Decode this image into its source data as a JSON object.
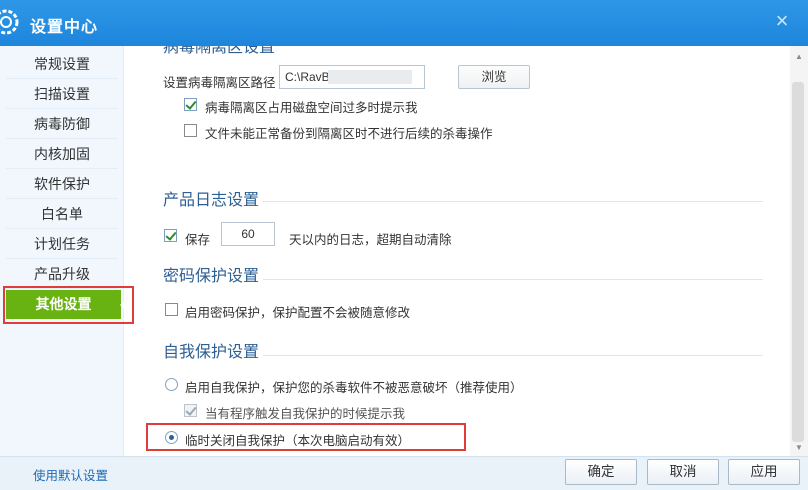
{
  "window": {
    "title": "设置中心",
    "close_glyph": "×"
  },
  "sidebar": {
    "items": [
      {
        "label": "常规设置"
      },
      {
        "label": "扫描设置"
      },
      {
        "label": "病毒防御"
      },
      {
        "label": "内核加固"
      },
      {
        "label": "软件保护"
      },
      {
        "label": "白名单"
      },
      {
        "label": "计划任务"
      },
      {
        "label": "产品升级"
      },
      {
        "label": "其他设置"
      }
    ],
    "selected": "其他设置"
  },
  "quarantine": {
    "heading_partial": "病毒隔离区设置",
    "path_label": "设置病毒隔离区路径",
    "path_value": "C:\\RavBin",
    "browse_label": "浏览",
    "opt_disk_warn": {
      "label": "病毒隔离区占用磁盘空间过多时提示我",
      "checked": true
    },
    "opt_no_backup": {
      "label": "文件未能正常备份到隔离区时不进行后续的杀毒操作",
      "checked": false
    }
  },
  "log": {
    "heading": "产品日志设置",
    "save_label": "保存",
    "save_checked": true,
    "days_value": "60",
    "suffix": "天以内的日志，超期自动清除"
  },
  "password": {
    "heading": "密码保护设置",
    "enable_label": "启用密码保护，保护配置不会被随意修改",
    "enable_checked": false
  },
  "selfprotect": {
    "heading": "自我保护设置",
    "opt_enable": {
      "label": "启用自我保护，保护您的杀毒软件不被恶意破坏（推荐使用）",
      "selected": false
    },
    "opt_notify": {
      "label": "当有程序触发自我保护的时候提示我",
      "checked": true,
      "disabled": true
    },
    "opt_temp_off": {
      "label": "临时关闭自我保护（本次电脑启动有效）",
      "selected": true
    }
  },
  "footer": {
    "defaults_link": "使用默认设置",
    "ok": "确定",
    "cancel": "取消",
    "apply": "应用"
  },
  "colors": {
    "titlebar": "#1d86dc",
    "active_item": "#68b311",
    "highlight": "#e03c3c",
    "heading": "#2d5f93"
  }
}
